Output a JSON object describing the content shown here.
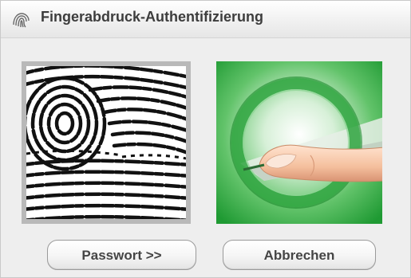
{
  "window": {
    "title": "Fingerabdruck-Authentifizierung",
    "title_icon": "fingerprint-icon"
  },
  "panels": {
    "fingerprint": {
      "icon": "fingerprint-scan-image"
    },
    "finger_sensor": {
      "icon": "finger-touch-sensor-image",
      "accent": "#3fae4a"
    }
  },
  "buttons": {
    "password_label": "Passwort >>",
    "cancel_label": "Abbrechen"
  }
}
